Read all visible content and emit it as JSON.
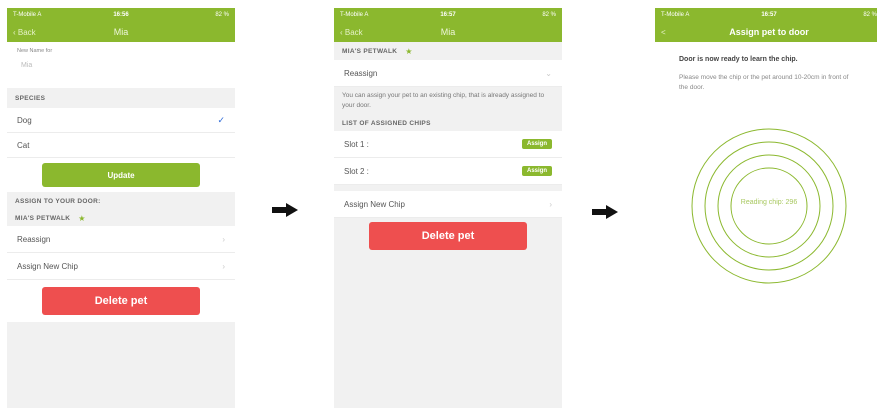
{
  "screens": [
    {
      "status": {
        "carrier": "T-Mobile A",
        "time": "16:56",
        "battery": "82 %"
      },
      "nav": {
        "back": "Back",
        "title": "Mia"
      },
      "name_field": {
        "label": "New Name for",
        "value": "Mia"
      },
      "species": {
        "label": "SPECIES",
        "options": [
          "Dog",
          "Cat"
        ],
        "selected": "Dog"
      },
      "update_button": "Update",
      "assign_label": "ASSIGN TO YOUR DOOR:",
      "petwalk": "MIA'S PETWALK",
      "rows": [
        "Reassign",
        "Assign New Chip"
      ],
      "delete_button": "Delete pet"
    },
    {
      "status": {
        "carrier": "T-Mobile A",
        "time": "16:57",
        "battery": "82 %"
      },
      "nav": {
        "back": "Back",
        "title": "Mia"
      },
      "petwalk": "MIA'S PETWALK",
      "reassign": "Reassign",
      "info": "You can assign your pet to an existing chip, that is already assigned to your door.",
      "chips_label": "LIST OF ASSIGNED CHIPS",
      "slots": [
        {
          "label": "Slot 1 :",
          "button": "Assign"
        },
        {
          "label": "Slot 2 :",
          "button": "Assign"
        }
      ],
      "assign_new": "Assign New Chip",
      "delete_button": "Delete pet"
    },
    {
      "status": {
        "carrier": "T-Mobile A",
        "time": "16:57",
        "battery": "82 %"
      },
      "nav": {
        "back": "<",
        "title": "Assign pet to door"
      },
      "heading": "Door is now ready to learn the chip.",
      "instruction": "Please move the chip or the pet around 10-20cm in front of the door.",
      "scan_text": "Reading chip: 296"
    }
  ],
  "colors": {
    "accent": "#8bb82e",
    "danger": "#ee4f4f",
    "check": "#2f6bd8"
  },
  "icons": {
    "flow": "arrow-right-icon",
    "star": "star-icon"
  }
}
